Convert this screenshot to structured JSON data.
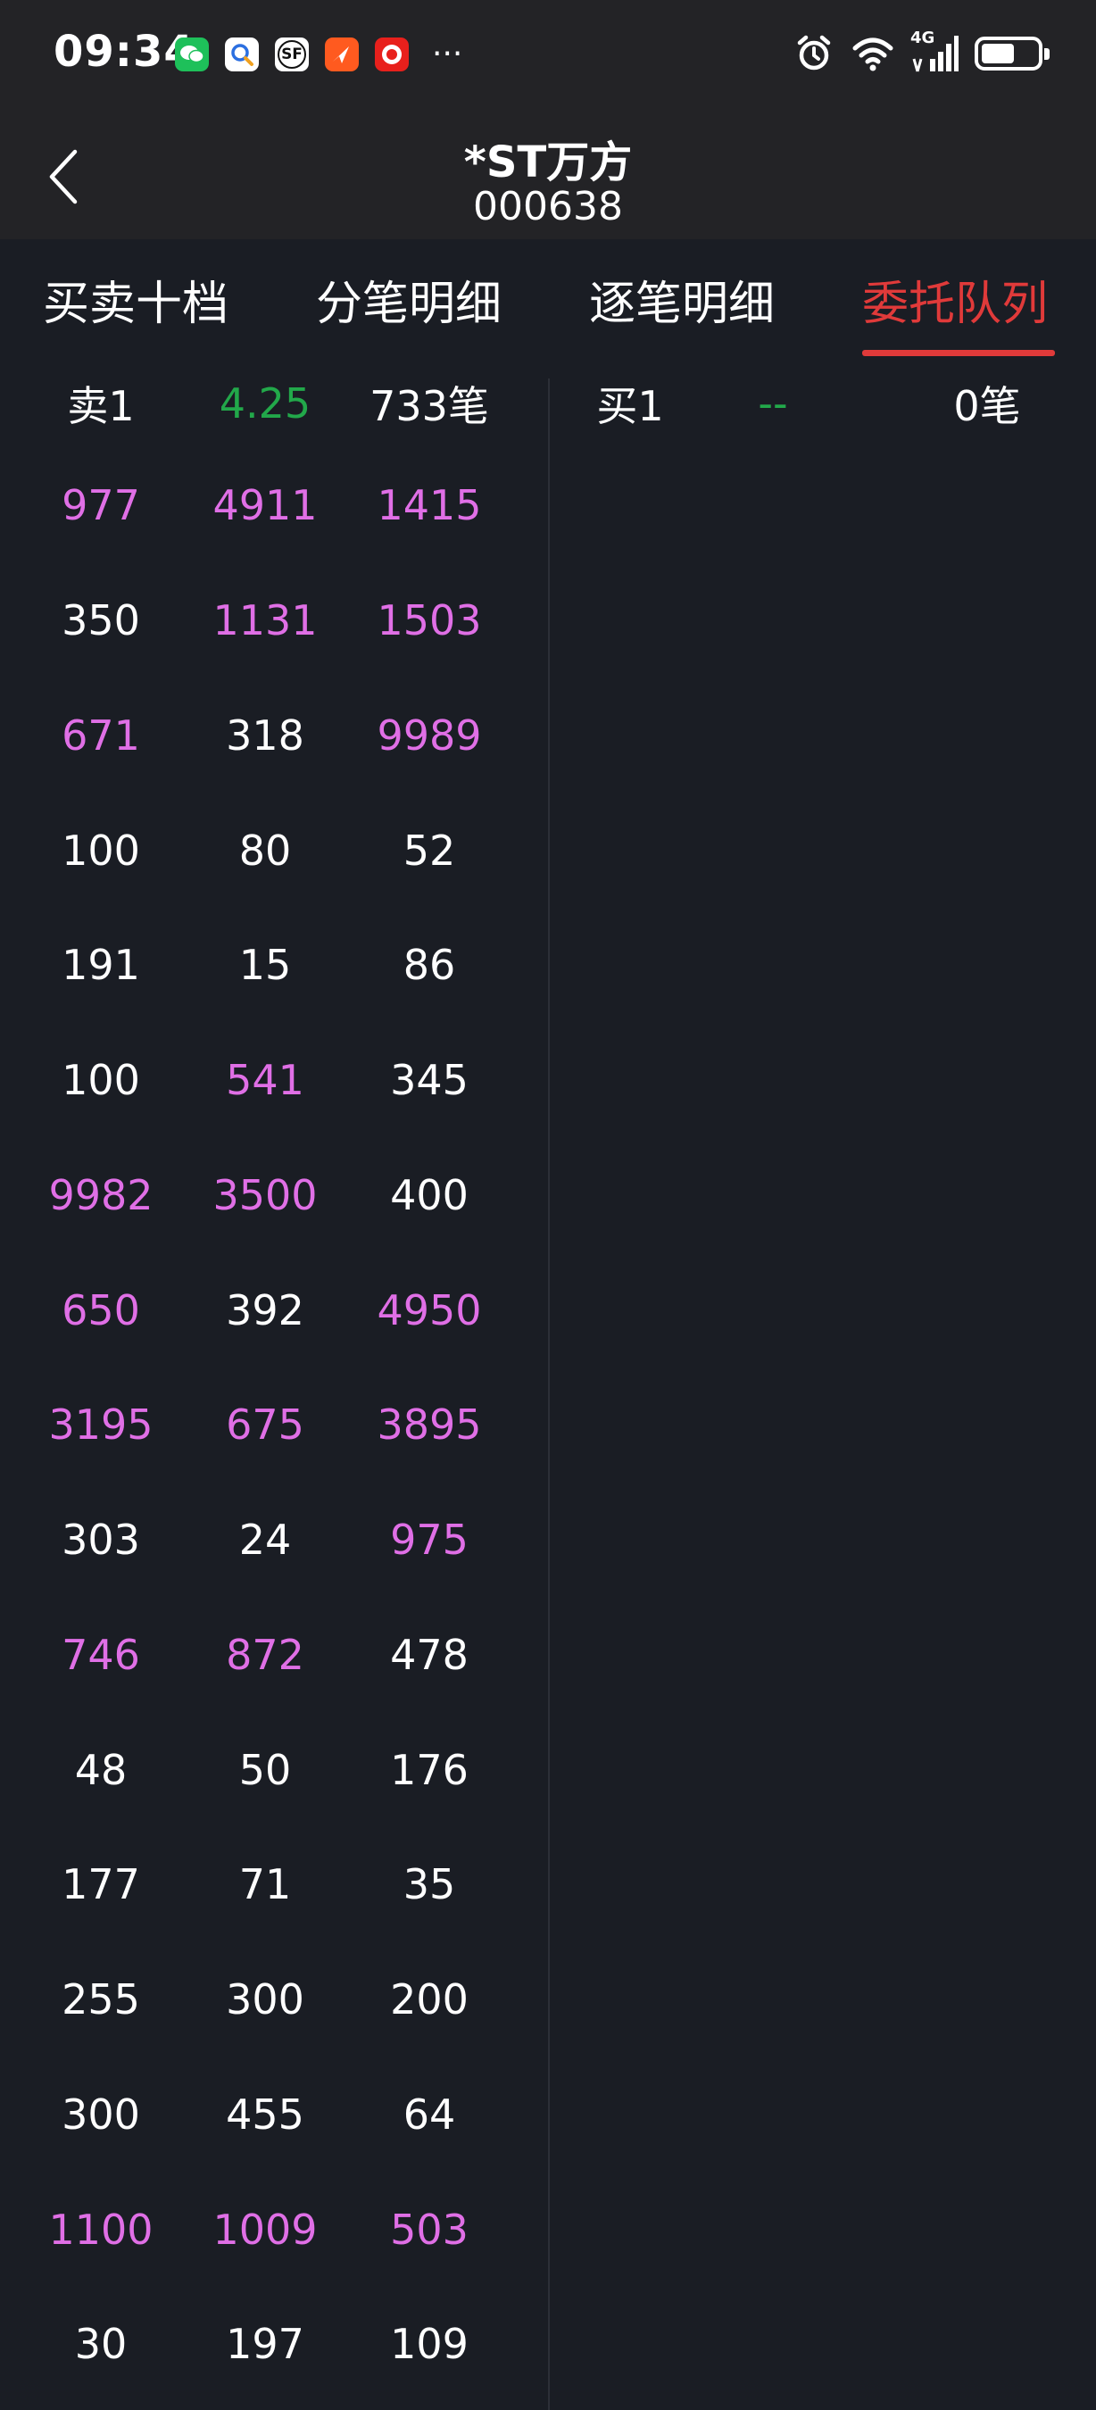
{
  "status_bar": {
    "time": "09:34",
    "notification_icons": [
      "wechat-icon",
      "search-app-icon",
      "sf-express-icon",
      "video-app-icon",
      "news-app-icon"
    ],
    "sf_label": "SF",
    "network_label": "4G",
    "battery_percent": 60
  },
  "header": {
    "title": "*ST万方",
    "code": "000638"
  },
  "tabs": [
    {
      "label": "买卖十档"
    },
    {
      "label": "分笔明细"
    },
    {
      "label": "逐笔明细"
    },
    {
      "label": "委托队列",
      "active": true
    }
  ],
  "sell": {
    "label": "卖1",
    "price": "4.25",
    "count": "733笔"
  },
  "buy": {
    "label": "买1",
    "price": "--",
    "count": "0笔"
  },
  "queue_rows": [
    [
      {
        "v": "977",
        "hl": true
      },
      {
        "v": "4911",
        "hl": true
      },
      {
        "v": "1415",
        "hl": true
      }
    ],
    [
      {
        "v": "350",
        "hl": false
      },
      {
        "v": "1131",
        "hl": true
      },
      {
        "v": "1503",
        "hl": true
      }
    ],
    [
      {
        "v": "671",
        "hl": true
      },
      {
        "v": "318",
        "hl": false
      },
      {
        "v": "9989",
        "hl": true
      }
    ],
    [
      {
        "v": "100",
        "hl": false
      },
      {
        "v": "80",
        "hl": false
      },
      {
        "v": "52",
        "hl": false
      }
    ],
    [
      {
        "v": "191",
        "hl": false
      },
      {
        "v": "15",
        "hl": false
      },
      {
        "v": "86",
        "hl": false
      }
    ],
    [
      {
        "v": "100",
        "hl": false
      },
      {
        "v": "541",
        "hl": true
      },
      {
        "v": "345",
        "hl": false
      }
    ],
    [
      {
        "v": "9982",
        "hl": true
      },
      {
        "v": "3500",
        "hl": true
      },
      {
        "v": "400",
        "hl": false
      }
    ],
    [
      {
        "v": "650",
        "hl": true
      },
      {
        "v": "392",
        "hl": false
      },
      {
        "v": "4950",
        "hl": true
      }
    ],
    [
      {
        "v": "3195",
        "hl": true
      },
      {
        "v": "675",
        "hl": true
      },
      {
        "v": "3895",
        "hl": true
      }
    ],
    [
      {
        "v": "303",
        "hl": false
      },
      {
        "v": "24",
        "hl": false
      },
      {
        "v": "975",
        "hl": true
      }
    ],
    [
      {
        "v": "746",
        "hl": true
      },
      {
        "v": "872",
        "hl": true
      },
      {
        "v": "478",
        "hl": false
      }
    ],
    [
      {
        "v": "48",
        "hl": false
      },
      {
        "v": "50",
        "hl": false
      },
      {
        "v": "176",
        "hl": false
      }
    ],
    [
      {
        "v": "177",
        "hl": false
      },
      {
        "v": "71",
        "hl": false
      },
      {
        "v": "35",
        "hl": false
      }
    ],
    [
      {
        "v": "255",
        "hl": false
      },
      {
        "v": "300",
        "hl": false
      },
      {
        "v": "200",
        "hl": false
      }
    ],
    [
      {
        "v": "300",
        "hl": false
      },
      {
        "v": "455",
        "hl": false
      },
      {
        "v": "64",
        "hl": false
      }
    ],
    [
      {
        "v": "1100",
        "hl": true
      },
      {
        "v": "1009",
        "hl": true
      },
      {
        "v": "503",
        "hl": true
      }
    ],
    [
      {
        "v": "30",
        "hl": false
      },
      {
        "v": "197",
        "hl": false
      },
      {
        "v": "109",
        "hl": false
      }
    ]
  ],
  "colors": {
    "background": "#1a1d24",
    "header_bg": "#232326",
    "accent_red": "#e03a3a",
    "sell_price_green": "#22a84a",
    "large_order_pink": "#e06fe6"
  }
}
